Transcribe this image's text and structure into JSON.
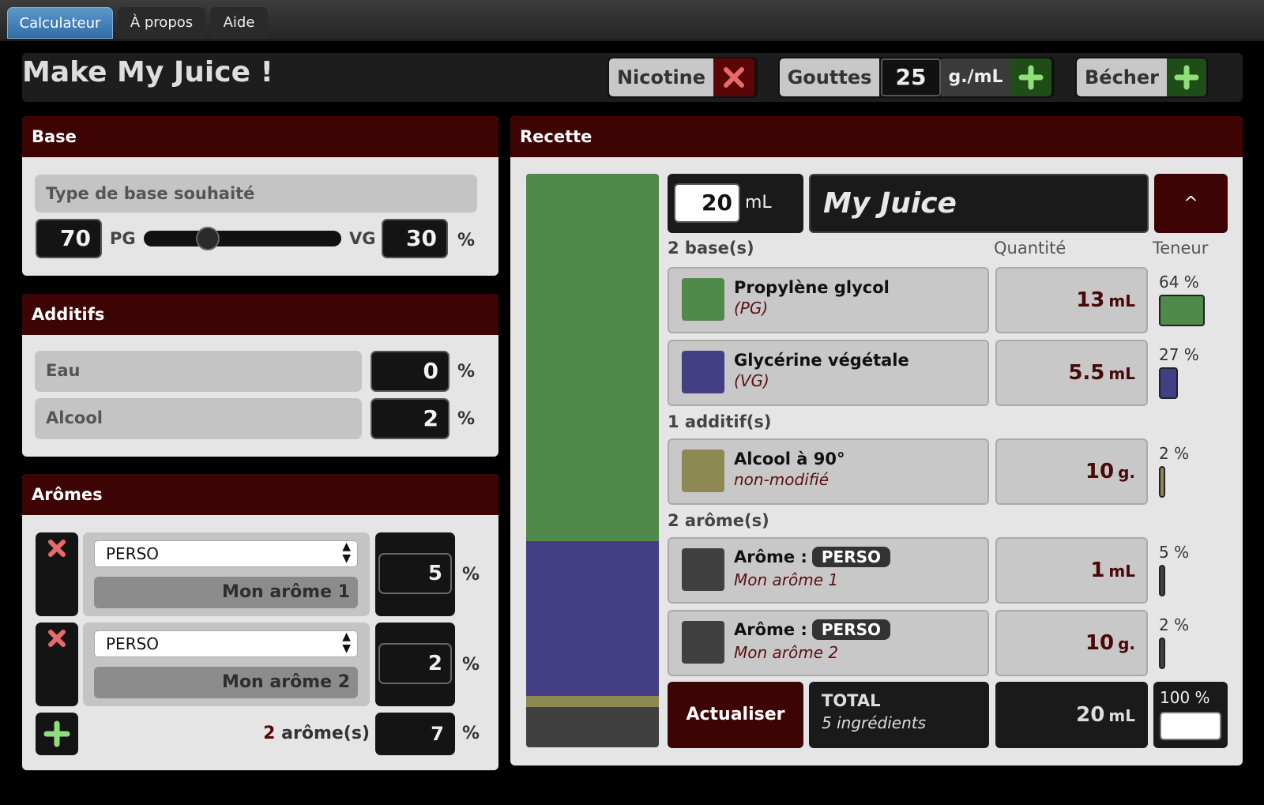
{
  "tabs": [
    {
      "label": "Calculateur",
      "active": true
    },
    {
      "label": "À propos",
      "active": false
    },
    {
      "label": "Aide",
      "active": false
    }
  ],
  "header": {
    "title": "Make My Juice !",
    "nicotine_label": "Nicotine",
    "gouttes_label": "Gouttes",
    "gouttes_value": "25",
    "gouttes_unit": "g./mL",
    "becher_label": "Bécher"
  },
  "base": {
    "title": "Base",
    "type_label": "Type de base souhaité",
    "pg_value": "70",
    "pg_label": "PG",
    "vg_label": "VG",
    "vg_value": "30",
    "pct": "%",
    "pg_ratio": 0.3
  },
  "additifs": {
    "title": "Additifs",
    "items": [
      {
        "label": "Eau",
        "value": "0",
        "unit": "%"
      },
      {
        "label": "Alcool",
        "value": "2",
        "unit": "%"
      }
    ]
  },
  "aromes": {
    "title": "Arômes",
    "items": [
      {
        "type": "PERSO",
        "name": "Mon arôme 1",
        "value": "5",
        "unit": "%"
      },
      {
        "type": "PERSO",
        "name": "Mon arôme 2",
        "value": "2",
        "unit": "%"
      }
    ],
    "count": "2",
    "count_label": "arôme(s)",
    "total": "7",
    "total_unit": "%"
  },
  "recette": {
    "title": "Recette",
    "volume": "20",
    "volume_unit": "mL",
    "name": "My Juice",
    "collapse_symbol": "^",
    "bases_header": "2 base(s)",
    "quantite_header": "Quantité",
    "teneur_header": "Teneur",
    "additifs_header": "1 additif(s)",
    "aromes_header": "2 arôme(s)",
    "ingredients": [
      {
        "title": "Propylène glycol",
        "sub": "(PG)",
        "qty": "13",
        "unit": "mL",
        "teneur": "64 %",
        "color": "#4f8a4a",
        "fraction": 0.64
      },
      {
        "title": "Glycérine végétale",
        "sub": "(VG)",
        "qty": "5.5",
        "unit": "mL",
        "teneur": "27 %",
        "color": "#433f85",
        "fraction": 0.27
      },
      {
        "title": "Alcool à 90°",
        "sub": "non-modifié",
        "qty": "10",
        "unit": "g.",
        "teneur": "2 %",
        "color": "#8c8a52",
        "fraction": 0.02
      },
      {
        "title": "Arôme :",
        "badge": "PERSO",
        "sub": "Mon arôme 1",
        "qty": "1",
        "unit": "mL",
        "teneur": "5 %",
        "color": "#404040",
        "fraction": 0.05
      },
      {
        "title": "Arôme :",
        "badge": "PERSO",
        "sub": "Mon arôme 2",
        "qty": "10",
        "unit": "g.",
        "teneur": "2 %",
        "color": "#404040",
        "fraction": 0.02
      }
    ],
    "actualiser_label": "Actualiser",
    "total_label": "TOTAL",
    "total_sub": "5 ingrédients",
    "total_volume": "20",
    "total_unit": "mL",
    "total_teneur": "100 %"
  }
}
